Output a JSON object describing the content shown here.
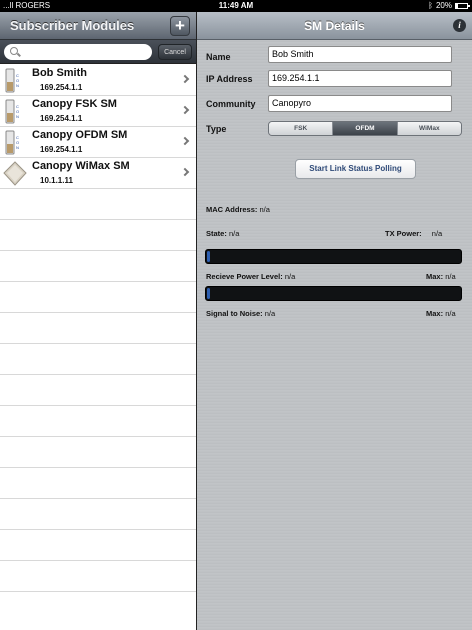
{
  "status_bar": {
    "carrier": "...ll ROGERS",
    "time": "11:49 AM",
    "battery_text": "20%",
    "battery_level": 0.2
  },
  "left_pane": {
    "title": "Subscriber Modules",
    "add_label": "+",
    "search_placeholder": "",
    "cancel_label": "Cancel",
    "items": [
      {
        "name": "Bob Smith",
        "ip": "169.254.1.1",
        "icon": "canopy-radio-icon"
      },
      {
        "name": "Canopy FSK SM",
        "ip": "169.254.1.1",
        "icon": "canopy-radio-icon"
      },
      {
        "name": "Canopy OFDM SM",
        "ip": "169.254.1.1",
        "icon": "canopy-radio-icon"
      },
      {
        "name": "Canopy WiMax SM",
        "ip": "10.1.1.11",
        "icon": "wimax-antenna-icon"
      }
    ],
    "empty_rows": 13
  },
  "right_pane": {
    "title": "SM Details",
    "info_icon": "i",
    "form": {
      "name_label": "Name",
      "name_value": "Bob Smith",
      "ip_label": "IP Address",
      "ip_value": "169.254.1.1",
      "community_label": "Community",
      "community_value": "Canopyro",
      "type_label": "Type",
      "type_options": [
        "FSK",
        "OFDM",
        "WiMax"
      ],
      "type_selected": "OFDM"
    },
    "poll_button": "Start Link Status Polling",
    "status": {
      "mac_label": "MAC Address:",
      "mac_value": "n/a",
      "state_label": "State:",
      "state_value": "n/a",
      "tx_label": "TX Power:",
      "tx_value": "n/a",
      "tx_bar_level": 0.01,
      "rx_label": "Recieve Power Level:",
      "rx_value": "n/a",
      "rx_max_label": "Max:",
      "rx_max_value": "n/a",
      "rx_bar_level": 0.01,
      "snr_label": "Signal to Noise:",
      "snr_value": "n/a",
      "snr_max_label": "Max:",
      "snr_max_value": "n/a"
    }
  },
  "colors": {
    "accent": "#2e5fb0",
    "button_text": "#2f4a78",
    "segment_selected": "#4a5058"
  }
}
